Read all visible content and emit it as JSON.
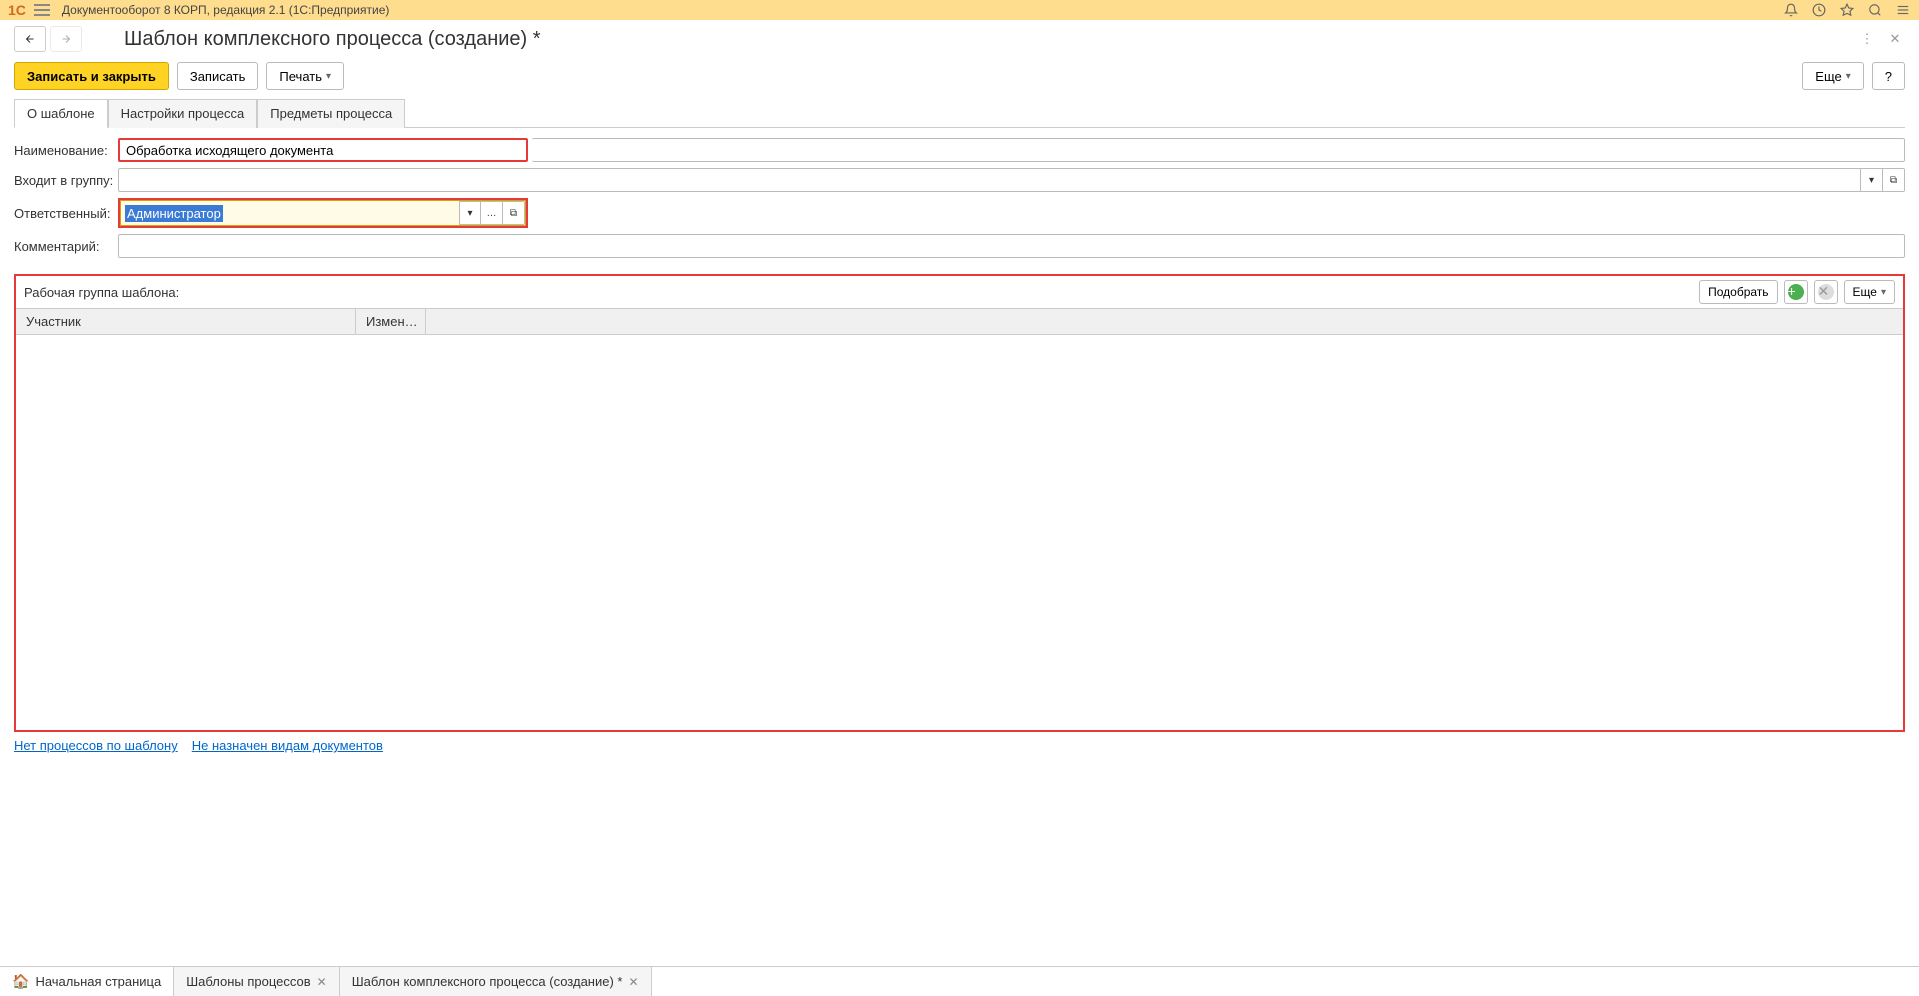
{
  "titlebar": {
    "app_title": "Документооборот 8 КОРП, редакция 2.1  (1С:Предприятие)"
  },
  "header": {
    "page_title": "Шаблон комплексного процесса (создание) *"
  },
  "toolbar": {
    "save_close": "Записать и закрыть",
    "save": "Записать",
    "print": "Печать",
    "more": "Еще",
    "help": "?"
  },
  "tabs": {
    "about": "О шаблоне",
    "settings": "Настройки процесса",
    "subjects": "Предметы процесса"
  },
  "form": {
    "name_label": "Наименование:",
    "name_value": "Обработка исходящего документа",
    "group_label": "Входит в группу:",
    "group_value": "",
    "responsible_label": "Ответственный:",
    "responsible_value": "Администратор",
    "comment_label": "Комментарий:",
    "comment_value": ""
  },
  "workgroup": {
    "title": "Рабочая группа шаблона:",
    "pick": "Подобрать",
    "more": "Еще",
    "col_participant": "Участник",
    "col_change": "Измен…"
  },
  "links": {
    "no_processes": "Нет процессов по шаблону",
    "not_assigned": "Не назначен видам документов"
  },
  "bottom_tabs": {
    "home": "Начальная страница",
    "templates": "Шаблоны процессов",
    "current": "Шаблон комплексного процесса (создание) *"
  }
}
